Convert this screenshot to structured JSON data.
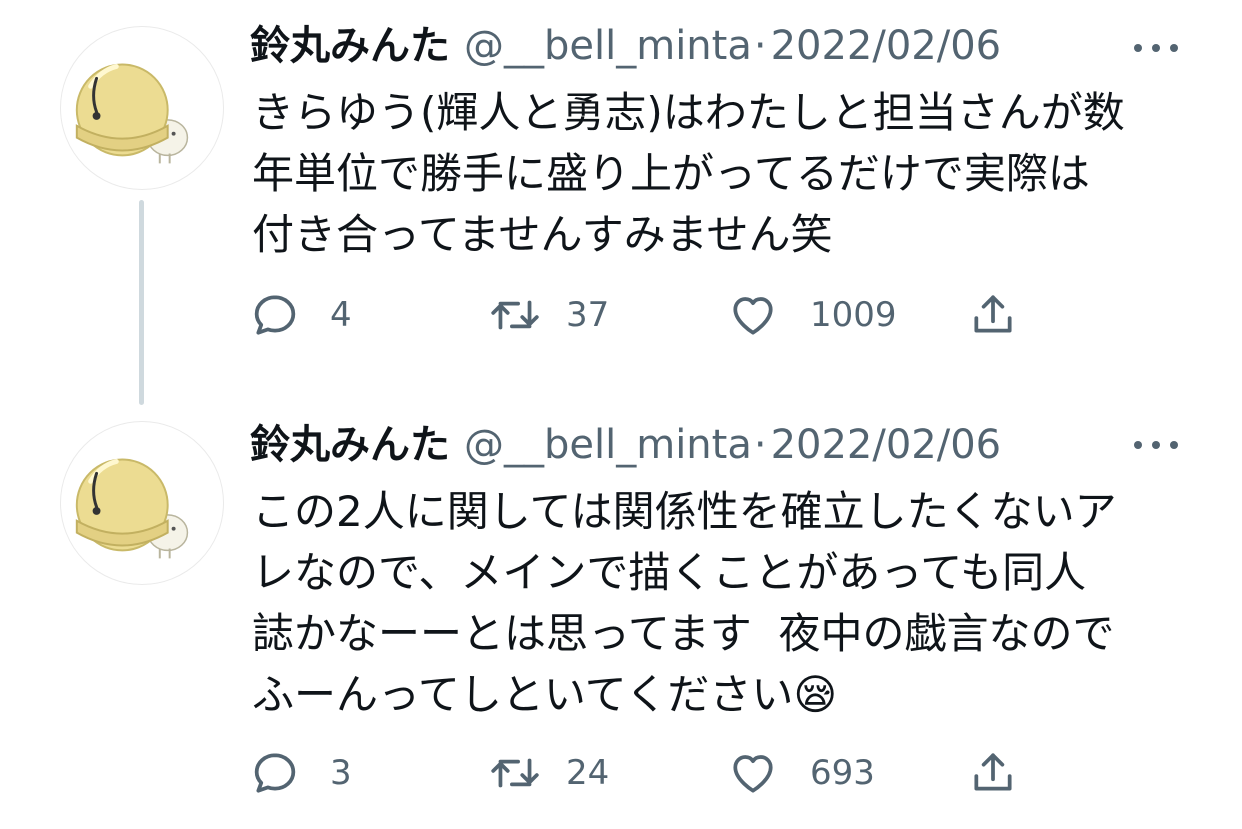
{
  "tweets": [
    {
      "display_name": "鈴丸みんた",
      "handle": "@__bell_minta",
      "separator": "·",
      "date": "2022/02/06",
      "text": "きらゆう(輝人と勇志)はわたしと担当さんが数\n年単位で勝手に盛り上がってるだけで実際は\n付き合ってませんすみません笑",
      "replies": "4",
      "retweets": "37",
      "likes": "1009",
      "icons": [
        "avatar-bell",
        "more-icon",
        "reply-icon",
        "retweet-icon",
        "like-icon",
        "share-icon"
      ]
    },
    {
      "display_name": "鈴丸みんた",
      "handle": "@__bell_minta",
      "separator": "·",
      "date": "2022/02/06",
      "text": "この2人に関しては関係性を確立したくないア\nレなので、メインで描くことがあっても同人\n誌かなーーとは思ってます  夜中の戯言なので\nふーんってしといてください😪",
      "replies": "3",
      "retweets": "24",
      "likes": "693",
      "icons": [
        "avatar-bell",
        "more-icon",
        "reply-icon",
        "retweet-icon",
        "like-icon",
        "share-icon"
      ]
    }
  ],
  "colors": {
    "text_primary": "#0f1419",
    "text_secondary": "#536471",
    "thread_line": "#cfd9de",
    "avatar_bell": "#ecdc92"
  }
}
